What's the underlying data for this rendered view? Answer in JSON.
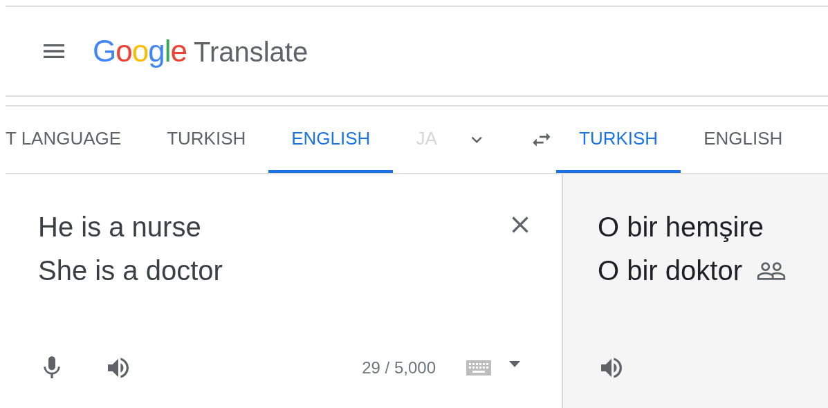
{
  "header": {
    "logo": "Google",
    "product": "Translate"
  },
  "source_tabs": [
    {
      "label": "T LANGUAGE",
      "selected": false,
      "faded": false
    },
    {
      "label": "TURKISH",
      "selected": false,
      "faded": false
    },
    {
      "label": "ENGLISH",
      "selected": true,
      "faded": false
    },
    {
      "label": "JA",
      "selected": false,
      "faded": true
    }
  ],
  "target_tabs": [
    {
      "label": "TURKISH",
      "selected": true
    },
    {
      "label": "ENGLISH",
      "selected": false
    }
  ],
  "source": {
    "lines": [
      "He is a nurse",
      "She is a doctor"
    ],
    "char_count": "29 / 5,000"
  },
  "target": {
    "lines": [
      "O bir hemşire",
      "O bir doktor"
    ]
  }
}
